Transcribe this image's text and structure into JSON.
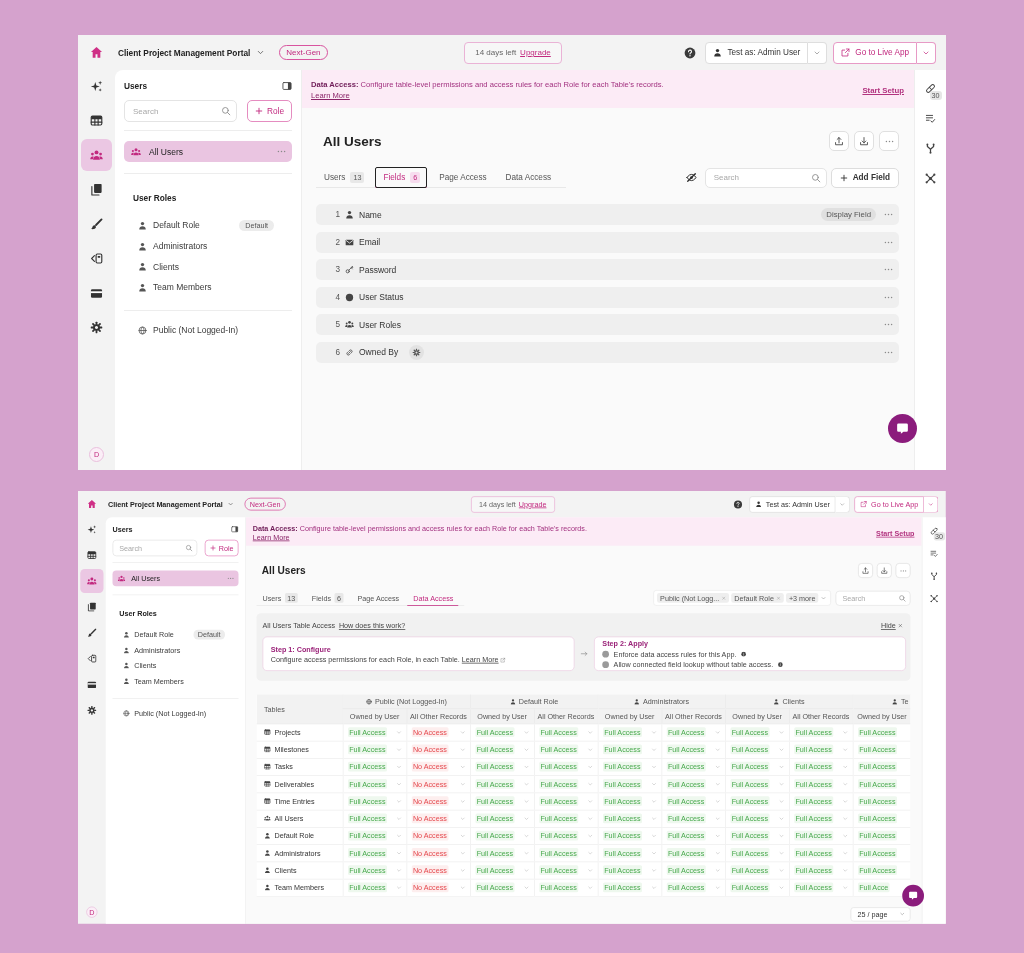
{
  "screens": [
    {
      "header": {
        "app_name": "Client Project Management Portal",
        "badge": "Next-Gen",
        "trial_text": "14 days left",
        "trial_link": "Upgrade",
        "test_as": "Test as: Admin User",
        "live_button": "Go to Live App"
      },
      "nav_rail": {
        "items": [
          {
            "selected": false
          },
          {
            "selected": false
          },
          {
            "selected": true
          },
          {
            "selected": false
          },
          {
            "selected": false
          },
          {
            "selected": false
          },
          {
            "selected": false
          },
          {
            "selected": false
          }
        ],
        "avatar": "D"
      },
      "sidebar": {
        "title": "Users",
        "search": {
          "placeholder": "Search"
        },
        "add_button": "Role",
        "all_users": {
          "label": "All Users",
          "selected": true
        },
        "roles_heading": "User Roles",
        "roles": [
          {
            "label": "Default Role",
            "badge": "Default",
            "selected": false
          },
          {
            "label": "Administrators",
            "selected": false
          },
          {
            "label": "Clients",
            "selected": false
          },
          {
            "label": "Team Members",
            "selected": false
          }
        ],
        "public": {
          "label": "Public (Not Logged-In)",
          "selected": false
        }
      },
      "banner": {
        "text": "**Data Access:** Configure table-level permissions and access rules for each Role for each Table's records.",
        "link": "Learn More",
        "action": "Start Setup"
      },
      "right_rail": {
        "badge": "30"
      },
      "main": {
        "kind": "fields",
        "title": "All Users",
        "tabs": [
          {
            "label": "Users",
            "count": "13",
            "selected": false
          },
          {
            "label": "Fields",
            "count": "6",
            "selected": true
          },
          {
            "label": "Page Access",
            "selected": false
          },
          {
            "label": "Data Access",
            "selected": false
          }
        ],
        "search": {
          "placeholder": "Search"
        },
        "add_button": "Add Field",
        "fields": [
          {
            "number": "1",
            "name": "Name",
            "badge": "Display Field",
            "settings_chip": false
          },
          {
            "number": "2",
            "name": "Email",
            "settings_chip": false
          },
          {
            "number": "3",
            "name": "Password",
            "settings_chip": false
          },
          {
            "number": "4",
            "name": "User Status",
            "settings_chip": false
          },
          {
            "number": "5",
            "name": "User Roles",
            "settings_chip": false
          },
          {
            "number": "6",
            "name": "Owned By",
            "settings_chip": true
          }
        ]
      }
    },
    {
      "header": {
        "app_name": "Client Project Management Portal",
        "badge": "Next-Gen",
        "trial_text": "14 days left",
        "trial_link": "Upgrade",
        "test_as": "Test as: Admin User",
        "live_button": "Go to Live App"
      },
      "nav_rail": {
        "items": [
          {
            "selected": false
          },
          {
            "selected": false
          },
          {
            "selected": true
          },
          {
            "selected": false
          },
          {
            "selected": false
          },
          {
            "selected": false
          },
          {
            "selected": false
          },
          {
            "selected": false
          }
        ],
        "avatar": "D"
      },
      "sidebar": {
        "title": "Users",
        "search": {
          "placeholder": "Search"
        },
        "add_button": "Role",
        "all_users": {
          "label": "All Users",
          "selected": true
        },
        "roles_heading": "User Roles",
        "roles": [
          {
            "label": "Default Role",
            "badge": "Default",
            "selected": false
          },
          {
            "label": "Administrators",
            "selected": false
          },
          {
            "label": "Clients",
            "selected": false
          },
          {
            "label": "Team Members",
            "selected": false
          }
        ],
        "public": {
          "label": "Public (Not Logged-In)",
          "selected": false
        }
      },
      "banner": {
        "text": "**Data Access:** Configure table-level permissions and access rules for each Role for each Table's records.",
        "link": "Learn More",
        "action": "Start Setup"
      },
      "right_rail": {
        "badge": "30"
      },
      "main": {
        "kind": "data_access",
        "title": "All Users",
        "tabs": [
          {
            "label": "Users",
            "count": "13",
            "selected": false
          },
          {
            "label": "Fields",
            "count": "6",
            "selected": false
          },
          {
            "label": "Page Access",
            "selected": false
          },
          {
            "label": "Data Access",
            "selected": true
          }
        ],
        "filters": [
          {
            "label": "Public (Not Logg..."
          },
          {
            "label": "Default Role"
          }
        ],
        "more_filters": "+3 more",
        "search": {
          "placeholder": "Search"
        },
        "info": {
          "title": "All Users Table Access",
          "help_link": "How does this work?",
          "hide": "Hide",
          "steps": [
            {
              "title": "Step 1: Configure",
              "text": "Configure access permissions for each Role, in each Table.",
              "link": "Learn More"
            },
            {
              "title": "Step 2: Apply",
              "options": [
                {
                  "label": "Enforce data access rules for this App.",
                  "on": false
                },
                {
                  "label": "Allow connected field lookup without table access.",
                  "on": false
                }
              ]
            }
          ]
        },
        "table": {
          "first_column": "Tables",
          "groups": [
            {
              "name": "Public (Not Logged-In)",
              "kind": "public",
              "columns": [
                "Owned by User",
                "All Other Records"
              ]
            },
            {
              "name": "Default Role",
              "kind": "role",
              "columns": [
                "Owned by User",
                "All Other Records"
              ]
            },
            {
              "name": "Administrators",
              "kind": "role",
              "columns": [
                "Owned by User",
                "All Other Records"
              ]
            },
            {
              "name": "Clients",
              "kind": "role",
              "columns": [
                "Owned by User",
                "All Other Records"
              ]
            },
            {
              "name": "Te",
              "kind": "role",
              "columns": [
                "Owned by User"
              ]
            }
          ],
          "rows": [
            {
              "name": "Projects",
              "kind": "data_table",
              "cells": [
                {
                  "text": "Full Access",
                  "allowed": true
                },
                {
                  "text": "No Access",
                  "allowed": false
                },
                {
                  "text": "Full Access",
                  "allowed": true
                },
                {
                  "text": "Full Access",
                  "allowed": true
                },
                {
                  "text": "Full Access",
                  "allowed": true
                },
                {
                  "text": "Full Access",
                  "allowed": true
                },
                {
                  "text": "Full Access",
                  "allowed": true
                },
                {
                  "text": "Full Access",
                  "allowed": true
                },
                {
                  "text": "Full Access",
                  "allowed": true
                }
              ]
            },
            {
              "name": "Milestones",
              "kind": "data_table",
              "cells": [
                {
                  "text": "Full Access",
                  "allowed": true
                },
                {
                  "text": "No Access",
                  "allowed": false
                },
                {
                  "text": "Full Access",
                  "allowed": true
                },
                {
                  "text": "Full Access",
                  "allowed": true
                },
                {
                  "text": "Full Access",
                  "allowed": true
                },
                {
                  "text": "Full Access",
                  "allowed": true
                },
                {
                  "text": "Full Access",
                  "allowed": true
                },
                {
                  "text": "Full Access",
                  "allowed": true
                },
                {
                  "text": "Full Access",
                  "allowed": true
                }
              ]
            },
            {
              "name": "Tasks",
              "kind": "data_table",
              "cells": [
                {
                  "text": "Full Access",
                  "allowed": true
                },
                {
                  "text": "No Access",
                  "allowed": false
                },
                {
                  "text": "Full Access",
                  "allowed": true
                },
                {
                  "text": "Full Access",
                  "allowed": true
                },
                {
                  "text": "Full Access",
                  "allowed": true
                },
                {
                  "text": "Full Access",
                  "allowed": true
                },
                {
                  "text": "Full Access",
                  "allowed": true
                },
                {
                  "text": "Full Access",
                  "allowed": true
                },
                {
                  "text": "Full Access",
                  "allowed": true
                }
              ]
            },
            {
              "name": "Deliverables",
              "kind": "data_table",
              "cells": [
                {
                  "text": "Full Access",
                  "allowed": true
                },
                {
                  "text": "No Access",
                  "allowed": false
                },
                {
                  "text": "Full Access",
                  "allowed": true
                },
                {
                  "text": "Full Access",
                  "allowed": true
                },
                {
                  "text": "Full Access",
                  "allowed": true
                },
                {
                  "text": "Full Access",
                  "allowed": true
                },
                {
                  "text": "Full Access",
                  "allowed": true
                },
                {
                  "text": "Full Access",
                  "allowed": true
                },
                {
                  "text": "Full Access",
                  "allowed": true
                }
              ]
            },
            {
              "name": "Time Entries",
              "kind": "data_table",
              "cells": [
                {
                  "text": "Full Access",
                  "allowed": true
                },
                {
                  "text": "No Access",
                  "allowed": false
                },
                {
                  "text": "Full Access",
                  "allowed": true
                },
                {
                  "text": "Full Access",
                  "allowed": true
                },
                {
                  "text": "Full Access",
                  "allowed": true
                },
                {
                  "text": "Full Access",
                  "allowed": true
                },
                {
                  "text": "Full Access",
                  "allowed": true
                },
                {
                  "text": "Full Access",
                  "allowed": true
                },
                {
                  "text": "Full Access",
                  "allowed": true
                }
              ]
            },
            {
              "name": "All Users",
              "kind": "users_table",
              "cells": [
                {
                  "text": "Full Access",
                  "allowed": true
                },
                {
                  "text": "No Access",
                  "allowed": false
                },
                {
                  "text": "Full Access",
                  "allowed": true
                },
                {
                  "text": "Full Access",
                  "allowed": true
                },
                {
                  "text": "Full Access",
                  "allowed": true
                },
                {
                  "text": "Full Access",
                  "allowed": true
                },
                {
                  "text": "Full Access",
                  "allowed": true
                },
                {
                  "text": "Full Access",
                  "allowed": true
                },
                {
                  "text": "Full Access",
                  "allowed": true
                }
              ]
            },
            {
              "name": "Default Role",
              "kind": "role_table",
              "cells": [
                {
                  "text": "Full Access",
                  "allowed": true
                },
                {
                  "text": "No Access",
                  "allowed": false
                },
                {
                  "text": "Full Access",
                  "allowed": true
                },
                {
                  "text": "Full Access",
                  "allowed": true
                },
                {
                  "text": "Full Access",
                  "allowed": true
                },
                {
                  "text": "Full Access",
                  "allowed": true
                },
                {
                  "text": "Full Access",
                  "allowed": true
                },
                {
                  "text": "Full Access",
                  "allowed": true
                },
                {
                  "text": "Full Access",
                  "allowed": true
                }
              ]
            },
            {
              "name": "Administrators",
              "kind": "role_table",
              "cells": [
                {
                  "text": "Full Access",
                  "allowed": true
                },
                {
                  "text": "No Access",
                  "allowed": false
                },
                {
                  "text": "Full Access",
                  "allowed": true
                },
                {
                  "text": "Full Access",
                  "allowed": true
                },
                {
                  "text": "Full Access",
                  "allowed": true
                },
                {
                  "text": "Full Access",
                  "allowed": true
                },
                {
                  "text": "Full Access",
                  "allowed": true
                },
                {
                  "text": "Full Access",
                  "allowed": true
                },
                {
                  "text": "Full Access",
                  "allowed": true
                }
              ]
            },
            {
              "name": "Clients",
              "kind": "role_table",
              "cells": [
                {
                  "text": "Full Access",
                  "allowed": true
                },
                {
                  "text": "No Access",
                  "allowed": false
                },
                {
                  "text": "Full Access",
                  "allowed": true
                },
                {
                  "text": "Full Access",
                  "allowed": true
                },
                {
                  "text": "Full Access",
                  "allowed": true
                },
                {
                  "text": "Full Access",
                  "allowed": true
                },
                {
                  "text": "Full Access",
                  "allowed": true
                },
                {
                  "text": "Full Access",
                  "allowed": true
                },
                {
                  "text": "Full Access",
                  "allowed": true
                }
              ]
            },
            {
              "name": "Team Members",
              "kind": "role_table",
              "cells": [
                {
                  "text": "Full Access",
                  "allowed": true
                },
                {
                  "text": "No Access",
                  "allowed": false
                },
                {
                  "text": "Full Access",
                  "allowed": true
                },
                {
                  "text": "Full Access",
                  "allowed": true
                },
                {
                  "text": "Full Access",
                  "allowed": true
                },
                {
                  "text": "Full Access",
                  "allowed": true
                },
                {
                  "text": "Full Access",
                  "allowed": true
                },
                {
                  "text": "Full Access",
                  "allowed": true
                },
                {
                  "text": "Full Acce",
                  "allowed": true
                }
              ]
            }
          ]
        },
        "pagination": "25 / page"
      }
    }
  ]
}
